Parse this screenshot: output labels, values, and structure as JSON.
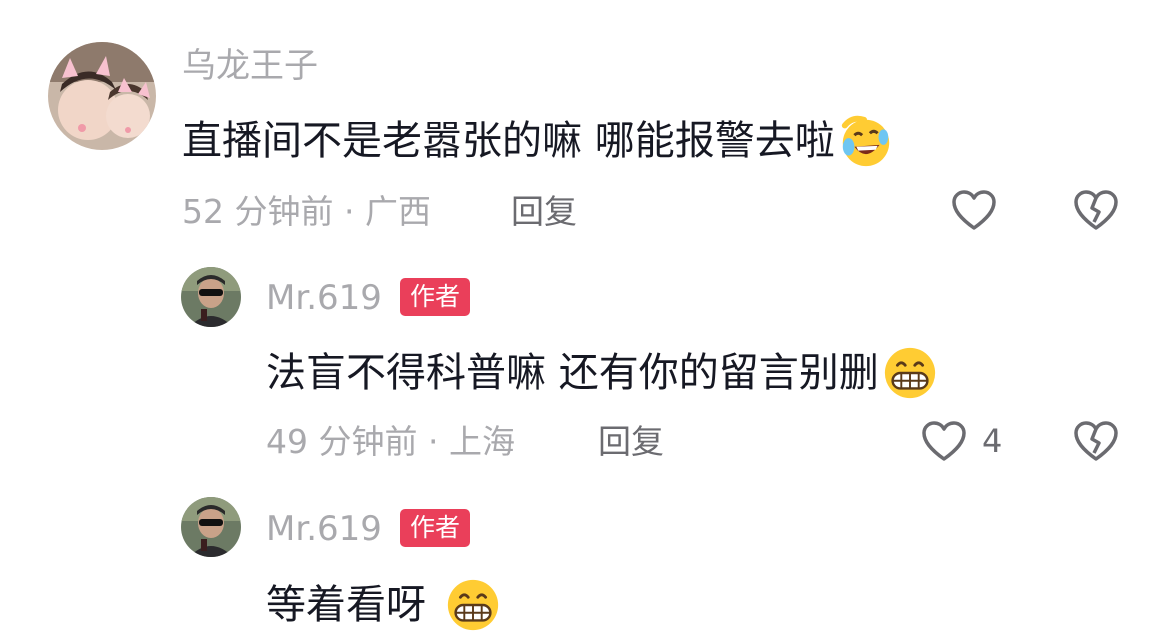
{
  "comments": [
    {
      "username": "乌龙王子",
      "text": "直播间不是老嚣张的嘛 哪能报警去啦",
      "emoji_icon": "rofl-emoji",
      "time": "52 分钟前",
      "location": "广西",
      "reply_label": "回复",
      "likes": ""
    },
    {
      "username": "Mr.619",
      "badge": "作者",
      "text": "法盲不得科普嘛 还有你的留言别删",
      "emoji_icon": "grin-emoji",
      "time": "49 分钟前",
      "location": "上海",
      "reply_label": "回复",
      "likes": "4"
    },
    {
      "username": "Mr.619",
      "badge": "作者",
      "text": "等着看呀",
      "emoji_icon": "grin-emoji"
    }
  ],
  "colors": {
    "badge": "#ea3f5a",
    "muted_text": "#a9a9ad",
    "body_text": "#161823",
    "icon_stroke": "#6b6b70"
  }
}
